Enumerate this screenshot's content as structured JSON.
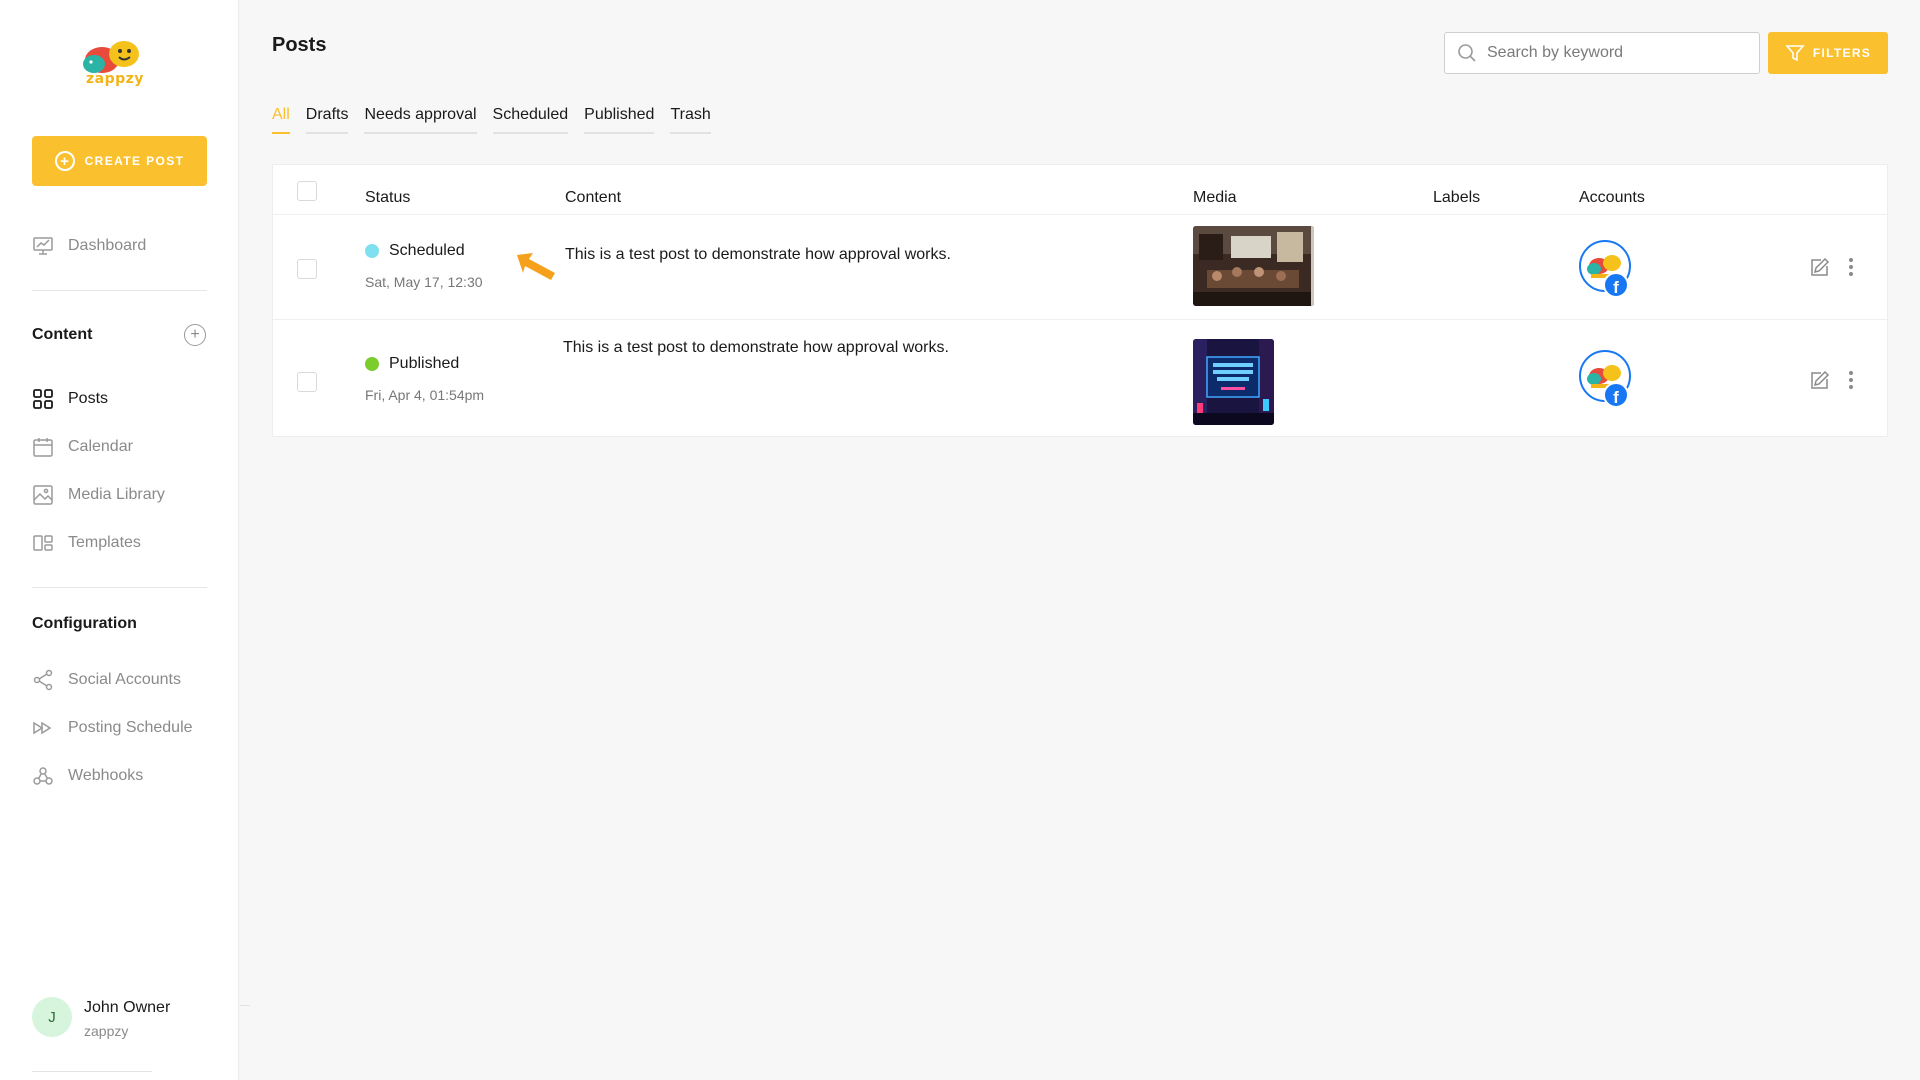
{
  "app": {
    "logo_text": "zappzy",
    "create_post_label": "CREATE POST"
  },
  "sidebar": {
    "dashboard": {
      "label": "Dashboard",
      "icon": "chart-board-icon"
    },
    "content_section": "Content",
    "content_items": [
      {
        "label": "Posts",
        "icon": "grid-icon",
        "active": true
      },
      {
        "label": "Calendar",
        "icon": "calendar-icon"
      },
      {
        "label": "Media Library",
        "icon": "image-icon"
      },
      {
        "label": "Templates",
        "icon": "layout-icon"
      }
    ],
    "configuration_section": "Configuration",
    "config_items": [
      {
        "label": "Social Accounts",
        "icon": "share-icon"
      },
      {
        "label": "Posting Schedule",
        "icon": "fast-forward-icon"
      },
      {
        "label": "Webhooks",
        "icon": "webhook-icon"
      }
    ],
    "user": {
      "initial": "J",
      "name": "John Owner",
      "org": "zappzy"
    }
  },
  "header": {
    "title": "Posts",
    "search_placeholder": "Search by keyword",
    "filters_label": "FILTERS"
  },
  "tabs": [
    "All",
    "Drafts",
    "Needs approval",
    "Scheduled",
    "Published",
    "Trash"
  ],
  "active_tab": "All",
  "table": {
    "columns": {
      "status": "Status",
      "content": "Content",
      "media": "Media",
      "labels": "Labels",
      "accounts": "Accounts"
    },
    "rows": [
      {
        "status": "Scheduled",
        "status_color": "#7fe0ef",
        "date": "Sat, May 17, 12:30",
        "content": "This is a test post to demonstrate how approval works.",
        "media": "meeting-room-photo",
        "account": "facebook"
      },
      {
        "status": "Published",
        "status_color": "#7ccc2e",
        "date": "Fri, Apr 4, 01:54pm",
        "content": "This is a test post to demonstrate how approval works.",
        "media": "social-media-billboard",
        "account": "facebook"
      }
    ]
  },
  "colors": {
    "accent": "#fbc02d",
    "facebook": "#1877f2",
    "arrow": "#f5a11c"
  }
}
